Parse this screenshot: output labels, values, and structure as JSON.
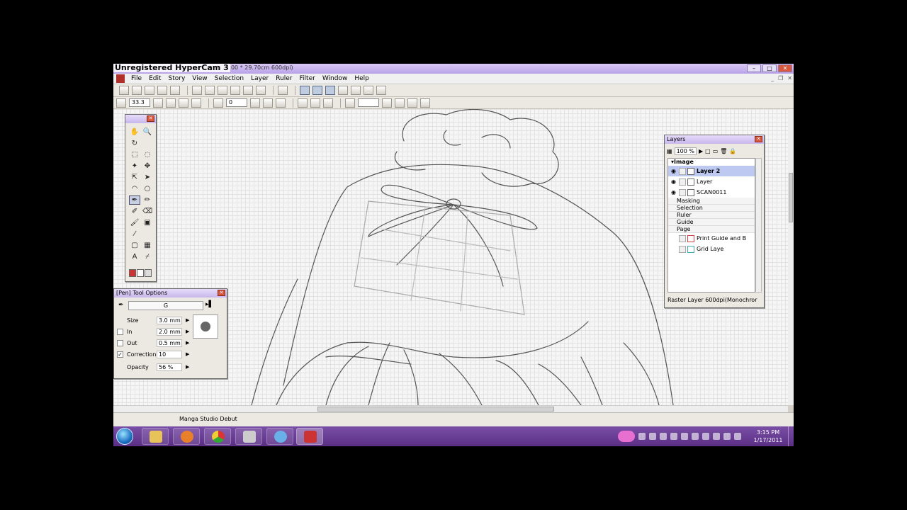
{
  "watermark": "Unregistered HyperCam 3",
  "window": {
    "title": "w Page] (21.00 * 29.70cm 600dpi)"
  },
  "menu": [
    "File",
    "Edit",
    "Story",
    "View",
    "Selection",
    "Layer",
    "Ruler",
    "Filter",
    "Window",
    "Help"
  ],
  "toolbar2": {
    "zoom": "33.3",
    "rotation": "0"
  },
  "tools_palette": {
    "tools": [
      "hand-icon",
      "zoom-icon",
      "rotate-icon",
      "",
      "rect-select-icon",
      "lasso-icon",
      "magic-wand-icon",
      "move-icon",
      "move-layer-icon",
      "object-select-icon",
      "curve-icon",
      "ellipse-icon",
      "pen-icon",
      "pencil-icon",
      "marker-icon",
      "eraser-icon",
      "brush-icon",
      "fill-icon",
      "tone-icon",
      "",
      "frame-icon",
      "tone-area-icon",
      "text-icon",
      "eyedropper-icon"
    ]
  },
  "pen_options": {
    "title": "[Pen] Tool Options",
    "pen_name": "G",
    "rows": [
      {
        "label": "Size",
        "value": "3.0 mm",
        "checkbox": false,
        "checked": false
      },
      {
        "label": "In",
        "value": "2.0 mm",
        "checkbox": true,
        "checked": false
      },
      {
        "label": "Out",
        "value": "0.5 mm",
        "checkbox": true,
        "checked": false
      },
      {
        "label": "Correction",
        "value": "10",
        "checkbox": true,
        "checked": true
      },
      {
        "label": "Opacity",
        "value": "56 %",
        "checkbox": false,
        "checked": false
      }
    ]
  },
  "layers": {
    "title": "Layers",
    "opacity": "100 %",
    "folder": "Image",
    "items": [
      {
        "name": "Layer 2",
        "selected": true
      },
      {
        "name": "Layer",
        "selected": false
      },
      {
        "name": "SCAN0011",
        "selected": false
      }
    ],
    "groups": [
      "Masking",
      "Selection",
      "Ruler",
      "Guide",
      "Page"
    ],
    "page_items": [
      "Print Guide and B",
      "Grid Laye"
    ],
    "status": "Raster Layer 600dpi(Monochror"
  },
  "status_bar": {
    "text": "Manga Studio Debut"
  },
  "taskbar": {
    "time": "3:15 PM",
    "date": "1/17/2011"
  },
  "colors": {
    "titlebar": "#c8b6ee",
    "taskbar": "#6a3e95",
    "selection": "#bdc9f0"
  }
}
